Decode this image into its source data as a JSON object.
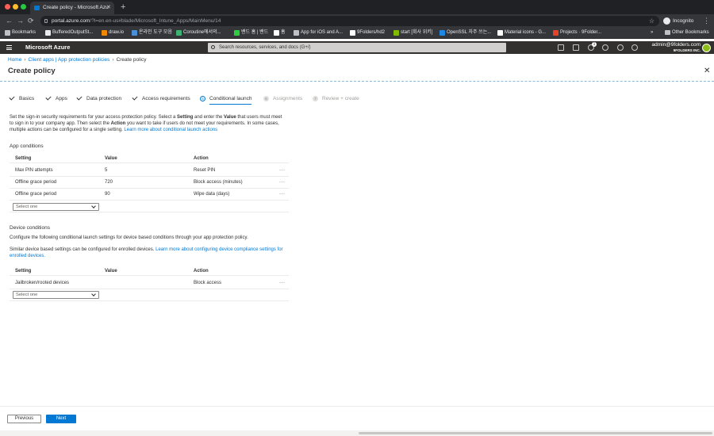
{
  "browser": {
    "tab_title": "Create policy - Microsoft Azu",
    "tab_close": "✕",
    "new_tab": "+",
    "back": "←",
    "forward": "→",
    "reload": "⟳",
    "url_host": "portal.azure.com",
    "url_path": "/?l=en.en-us#blade/Microsoft_Intune_Apps/MainMenu/14",
    "star": "☆",
    "incognito_label": "Incognito",
    "menu": "⋮",
    "bookmarks_more": "»",
    "bookmarks": [
      {
        "label": "Bookmarks",
        "color": "#bdc1c6"
      },
      {
        "label": "BufferedOutputSt...",
        "color": "#e8eaed"
      },
      {
        "label": "draw.io",
        "color": "#f08705"
      },
      {
        "label": "온라인 도구 모음",
        "color": "#4a90d9"
      },
      {
        "label": "Coroutine에서의...",
        "color": "#3cb371"
      },
      {
        "label": "밴드 홈 | 밴드",
        "color": "#2ecc40"
      },
      {
        "label": "홈",
        "color": "#ffffff"
      },
      {
        "label": "App for iOS and A...",
        "color": "#bdc1c6"
      },
      {
        "label": "9Folders/hd2",
        "color": "#ffffff"
      },
      {
        "label": "start [회사 위키]",
        "color": "#7fba00"
      },
      {
        "label": "OpenSSL 자주 쓰는...",
        "color": "#1e88e5"
      },
      {
        "label": "Material icons - G...",
        "color": "#ffffff"
      },
      {
        "label": "Projects · 9Folder...",
        "color": "#e24329"
      }
    ],
    "other_bookmarks": "Other Bookmarks"
  },
  "azure": {
    "brand": "Microsoft Azure",
    "search_placeholder": "Search resources, services, and docs (G+/)",
    "notification_count": "1",
    "user_name": "admin@9folders.com",
    "tenant": "9FOLDERS INC."
  },
  "page": {
    "breadcrumbs": [
      "Home",
      "Client apps | App protection policies",
      "Create policy"
    ],
    "title": "Create policy",
    "close": "✕"
  },
  "steps": [
    {
      "label": "Basics",
      "state": "done"
    },
    {
      "label": "Apps",
      "state": "done"
    },
    {
      "label": "Data protection",
      "state": "done"
    },
    {
      "label": "Access requirements",
      "state": "done"
    },
    {
      "label": "Conditional launch",
      "state": "active",
      "num": "5"
    },
    {
      "label": "Assignments",
      "state": "disabled",
      "num": "6"
    },
    {
      "label": "Review + create",
      "state": "disabled",
      "num": "7"
    }
  ],
  "intro": {
    "t1": "Set the sign-in security requirements for your access protection policy. Select a ",
    "b1": "Setting",
    "t2": " and enter the ",
    "b2": "Value",
    "t3": " that users must meet to sign in to your company app. Then select the ",
    "b3": "Action",
    "t4": " you want to take if users do not meet your requirements. In some cases, multiple actions can be configured for a single setting. ",
    "link": "Learn more about conditional launch actions"
  },
  "app_conditions": {
    "title": "App conditions",
    "columns": [
      "Setting",
      "Value",
      "Action"
    ],
    "rows": [
      {
        "setting": "Max PIN attempts",
        "value": "5",
        "action": "Reset PIN",
        "more": "···"
      },
      {
        "setting": "Offline grace period",
        "value": "720",
        "action": "Block access (minutes)",
        "more": "···"
      },
      {
        "setting": "Offline grace period",
        "value": "90",
        "action": "Wipe data (days)",
        "more": "···"
      }
    ],
    "select_placeholder": "Select one"
  },
  "device_conditions": {
    "title": "Device conditions",
    "desc": "Configure the following conditional launch settings for device based conditions through your app protection policy.",
    "note_text": "Similar device based settings can be configured for enrolled devices. ",
    "note_link": "Learn more about configuring device compliance settings for enrolled devices.",
    "columns": [
      "Setting",
      "Value",
      "Action"
    ],
    "rows": [
      {
        "setting": "Jailbroken/rooted devices",
        "value": "",
        "action": "Block access",
        "more": "···"
      }
    ],
    "select_placeholder": "Select one"
  },
  "footer": {
    "previous": "Previous",
    "next": "Next"
  },
  "colors": {
    "accent": "#0078d4",
    "header_bg": "#323130",
    "browser_dark": "#202124"
  }
}
